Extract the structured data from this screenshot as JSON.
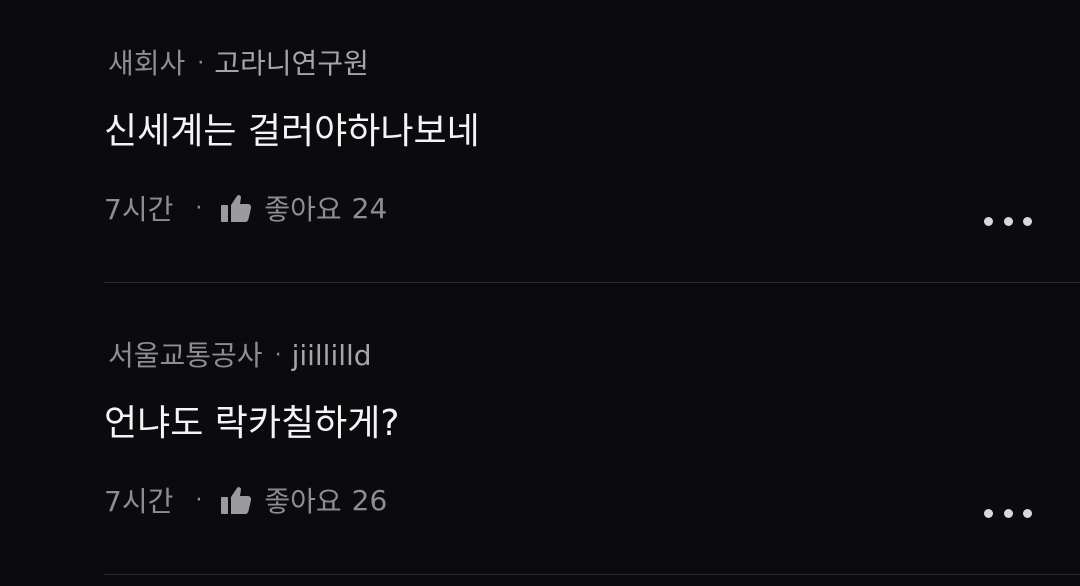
{
  "comments": [
    {
      "group": "새회사",
      "separator": "·",
      "author": "고라니연구원",
      "text": "신세계는 걸러야하나보네",
      "time": "7시간",
      "footer_separator": "·",
      "like_label": "좋아요",
      "like_count": "24",
      "like_icon": "thumbs-up-icon",
      "more_icon": "more-horizontal-icon"
    },
    {
      "group": "서울교통공사",
      "separator": "·",
      "author": "jiillilld",
      "text": "언냐도 락카칠하게?",
      "time": "7시간",
      "footer_separator": "·",
      "like_label": "좋아요",
      "like_count": "26",
      "like_icon": "thumbs-up-icon",
      "more_icon": "more-horizontal-icon"
    }
  ],
  "colors": {
    "background": "#0b0b0d",
    "meta_text": "#8d8d93",
    "body_text": "#f4f4f6",
    "divider": "#2c2c30",
    "more_dots": "#d8d8dc"
  }
}
